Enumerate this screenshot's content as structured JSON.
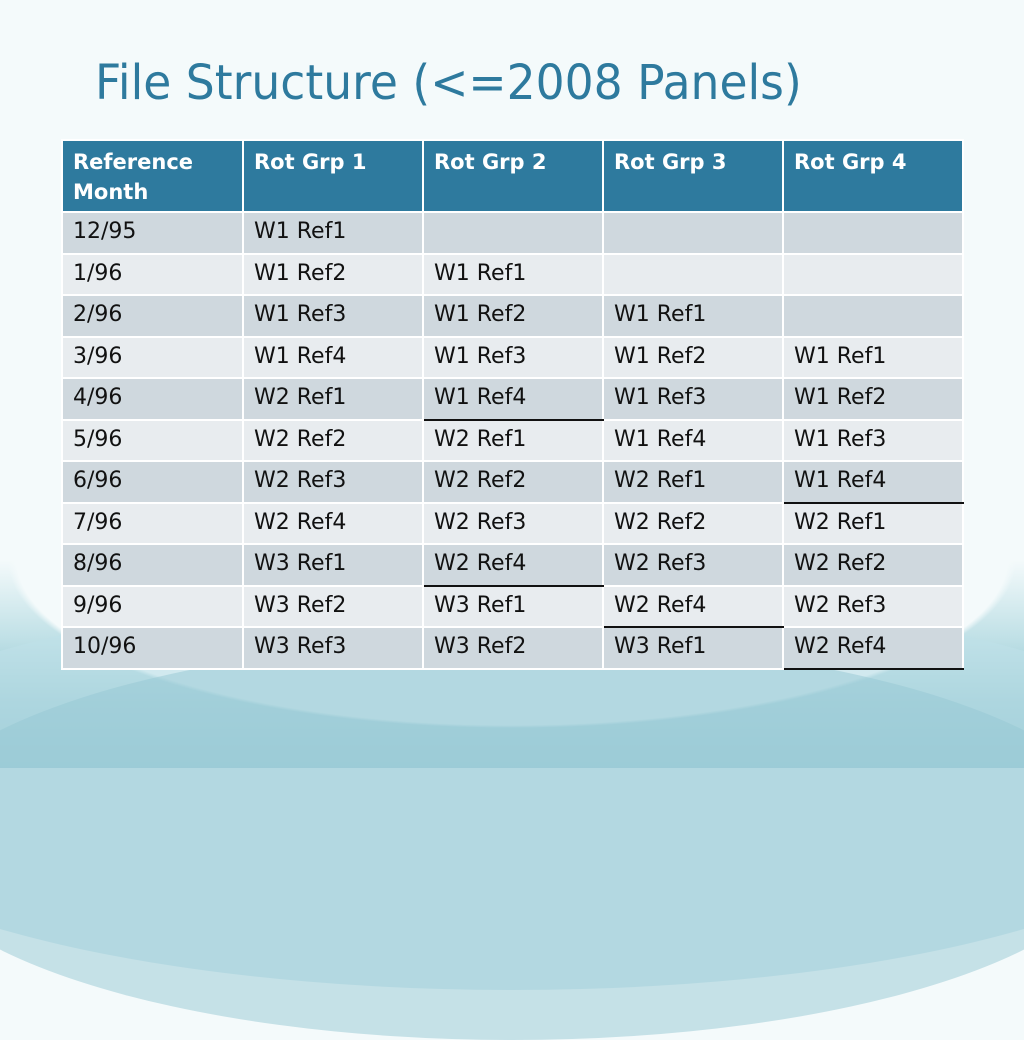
{
  "slide": {
    "title": "File Structure (<=2008 Panels)"
  },
  "table": {
    "headers": [
      "Reference Month",
      "Rot Grp 1",
      "Rot Grp 2",
      "Rot Grp 3",
      "Rot Grp 4"
    ],
    "rows": [
      [
        "12/95",
        "W1 Ref1",
        "",
        "",
        ""
      ],
      [
        "1/96",
        "W1 Ref2",
        "W1 Ref1",
        "",
        ""
      ],
      [
        "2/96",
        "W1 Ref3",
        "W1 Ref2",
        "W1 Ref1",
        ""
      ],
      [
        "3/96",
        "W1 Ref4",
        "W1 Ref3",
        "W1 Ref2",
        "W1 Ref1"
      ],
      [
        "4/96",
        "W2 Ref1",
        "W1 Ref4",
        "W1 Ref3",
        "W1 Ref2"
      ],
      [
        "5/96",
        "W2 Ref2",
        "W2 Ref1",
        "W1 Ref4",
        "W1 Ref3"
      ],
      [
        "6/96",
        "W2 Ref3",
        "W2 Ref2",
        "W2 Ref1",
        "W1 Ref4"
      ],
      [
        "7/96",
        "W2 Ref4",
        "W2 Ref3",
        "W2 Ref2",
        "W2 Ref1"
      ],
      [
        "8/96",
        "W3 Ref1",
        "W2 Ref4",
        "W2 Ref3",
        "W2 Ref2"
      ],
      [
        "9/96",
        "W3 Ref2",
        "W3 Ref1",
        "W2 Ref4",
        "W2 Ref3"
      ],
      [
        "10/96",
        "W3 Ref3",
        "W3 Ref2",
        "W3 Ref1",
        "W2 Ref4"
      ]
    ]
  },
  "colors": {
    "title": "#2e7a9e",
    "header_bg": "#2e7a9e",
    "row_dark": "#cfd8de",
    "row_light": "#e8ecef",
    "wave_boundary_line": "#111111"
  }
}
